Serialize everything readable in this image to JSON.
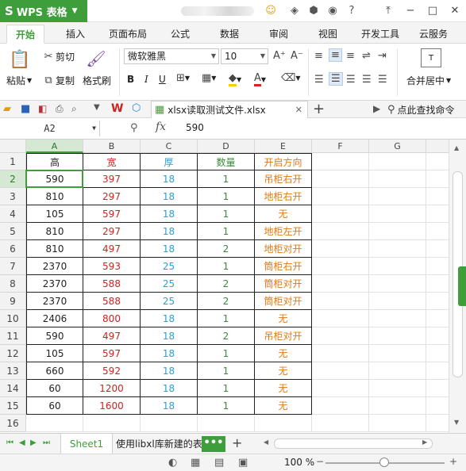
{
  "app": {
    "name": "WPS 表格",
    "logo_glyph": "S"
  },
  "ribbon_tabs": [
    "开始",
    "插入",
    "页面布局",
    "公式",
    "数据",
    "审阅",
    "视图",
    "开发工具",
    "云服务"
  ],
  "ribbon": {
    "paste": "粘贴",
    "cut": "剪切",
    "copy": "复制",
    "format_painter": "格式刷",
    "font_name": "微软雅黑",
    "font_size": "10",
    "bold": "B",
    "italic": "I",
    "underline": "U",
    "font_color_glyph": "A",
    "merge_center": "合并居中"
  },
  "quick": {
    "doc_name": "xlsx读取测试文件.xlsx",
    "search_label": "点此查找命令"
  },
  "formula_bar": {
    "name_box": "A2",
    "fx": "fx",
    "value": "590"
  },
  "grid": {
    "columns": [
      "A",
      "B",
      "C",
      "D",
      "E",
      "F",
      "G"
    ],
    "rows": [
      "1",
      "2",
      "3",
      "4",
      "5",
      "6",
      "7",
      "8",
      "9",
      "10",
      "11",
      "12",
      "13",
      "14",
      "15",
      "16"
    ],
    "headers": [
      "高",
      "宽",
      "厚",
      "数量",
      "开启方向"
    ],
    "data": [
      [
        "590",
        "397",
        "18",
        "1",
        "吊柜右开"
      ],
      [
        "810",
        "297",
        "18",
        "1",
        "地柜右开"
      ],
      [
        "105",
        "597",
        "18",
        "1",
        "无"
      ],
      [
        "810",
        "297",
        "18",
        "1",
        "地柜左开"
      ],
      [
        "810",
        "497",
        "18",
        "2",
        "地柜对开"
      ],
      [
        "2370",
        "593",
        "25",
        "1",
        "筒柜右开"
      ],
      [
        "2370",
        "588",
        "25",
        "2",
        "筒柜对开"
      ],
      [
        "2370",
        "588",
        "25",
        "2",
        "筒柜对开"
      ],
      [
        "2406",
        "800",
        "18",
        "1",
        "无"
      ],
      [
        "590",
        "497",
        "18",
        "2",
        "吊柜对开"
      ],
      [
        "105",
        "597",
        "18",
        "1",
        "无"
      ],
      [
        "660",
        "592",
        "18",
        "1",
        "无"
      ],
      [
        "60",
        "1200",
        "18",
        "1",
        "无"
      ],
      [
        "60",
        "1600",
        "18",
        "1",
        "无"
      ]
    ],
    "column_colors": [
      "#222222",
      "#d32020",
      "#2aa0d8",
      "#3a8a3a",
      "#e07a10"
    ]
  },
  "sheets": {
    "active": "Sheet1",
    "second": "使用libxl库新建的表",
    "more": "•••"
  },
  "status": {
    "zoom": "100 %"
  },
  "colors": {
    "accent": "#3f9e3c"
  }
}
